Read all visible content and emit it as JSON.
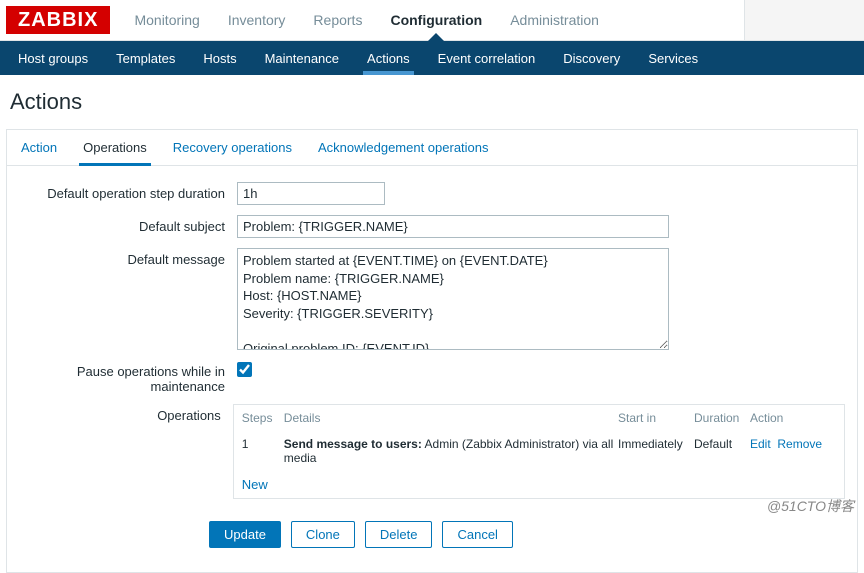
{
  "logo": "ZABBIX",
  "main_nav": {
    "items": [
      {
        "label": "Monitoring"
      },
      {
        "label": "Inventory"
      },
      {
        "label": "Reports"
      },
      {
        "label": "Configuration",
        "active": true
      },
      {
        "label": "Administration"
      }
    ]
  },
  "sub_nav": {
    "items": [
      {
        "label": "Host groups"
      },
      {
        "label": "Templates"
      },
      {
        "label": "Hosts"
      },
      {
        "label": "Maintenance"
      },
      {
        "label": "Actions",
        "active": true
      },
      {
        "label": "Event correlation"
      },
      {
        "label": "Discovery"
      },
      {
        "label": "Services"
      }
    ]
  },
  "page_title": "Actions",
  "tabs": [
    {
      "label": "Action"
    },
    {
      "label": "Operations",
      "active": true
    },
    {
      "label": "Recovery operations"
    },
    {
      "label": "Acknowledgement operations"
    }
  ],
  "form": {
    "duration_label": "Default operation step duration",
    "duration_value": "1h",
    "subject_label": "Default subject",
    "subject_value": "Problem: {TRIGGER.NAME}",
    "message_label": "Default message",
    "message_value": "Problem started at {EVENT.TIME} on {EVENT.DATE}\nProblem name: {TRIGGER.NAME}\nHost: {HOST.NAME}\nSeverity: {TRIGGER.SEVERITY}\n\nOriginal problem ID: {EVENT.ID}\n{TRIGGER.URL}",
    "pause_label": "Pause operations while in maintenance",
    "pause_checked": true,
    "operations_label": "Operations"
  },
  "ops_table": {
    "headers": {
      "steps": "Steps",
      "details": "Details",
      "start": "Start in",
      "duration": "Duration",
      "action": "Action"
    },
    "rows": [
      {
        "steps": "1",
        "details_bold": "Send message to users:",
        "details_rest": " Admin (Zabbix Administrator) via all media",
        "start": "Immediately",
        "duration": "Default",
        "edit": "Edit",
        "remove": "Remove"
      }
    ],
    "new": "New"
  },
  "buttons": {
    "update": "Update",
    "clone": "Clone",
    "delete": "Delete",
    "cancel": "Cancel"
  },
  "watermark": "@51CTO博客"
}
